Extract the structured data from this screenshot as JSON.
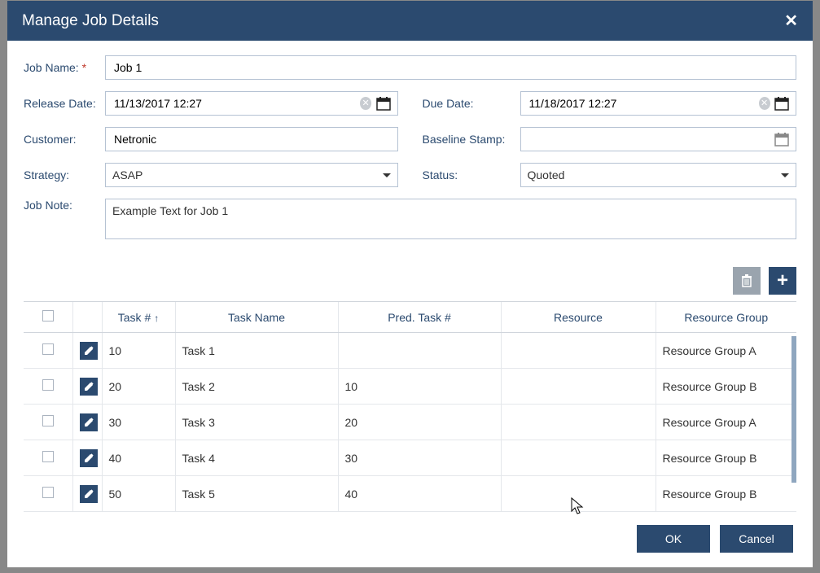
{
  "dialog": {
    "title": "Manage Job Details"
  },
  "form": {
    "job_name_label": "Job Name:",
    "job_name_value": "Job 1",
    "release_date_label": "Release Date:",
    "release_date_value": "11/13/2017 12:27",
    "due_date_label": "Due Date:",
    "due_date_value": "11/18/2017 12:27",
    "customer_label": "Customer:",
    "customer_value": "Netronic",
    "baseline_label": "Baseline Stamp:",
    "baseline_value": "",
    "strategy_label": "Strategy:",
    "strategy_value": "ASAP",
    "status_label": "Status:",
    "status_value": "Quoted",
    "job_note_label": "Job Note:",
    "job_note_value": "Example Text for Job 1"
  },
  "table": {
    "headers": {
      "task_num": "Task #",
      "task_name": "Task Name",
      "pred": "Pred. Task #",
      "resource": "Resource",
      "resource_group": "Resource Group"
    },
    "rows": [
      {
        "num": "10",
        "name": "Task 1",
        "pred": "",
        "res": "",
        "grp": "Resource Group A"
      },
      {
        "num": "20",
        "name": "Task 2",
        "pred": "10",
        "res": "",
        "grp": "Resource Group B"
      },
      {
        "num": "30",
        "name": "Task 3",
        "pred": "20",
        "res": "",
        "grp": "Resource Group A"
      },
      {
        "num": "40",
        "name": "Task 4",
        "pred": "30",
        "res": "",
        "grp": "Resource Group B"
      },
      {
        "num": "50",
        "name": "Task 5",
        "pred": "40",
        "res": "",
        "grp": "Resource Group B"
      }
    ]
  },
  "footer": {
    "ok": "OK",
    "cancel": "Cancel"
  }
}
